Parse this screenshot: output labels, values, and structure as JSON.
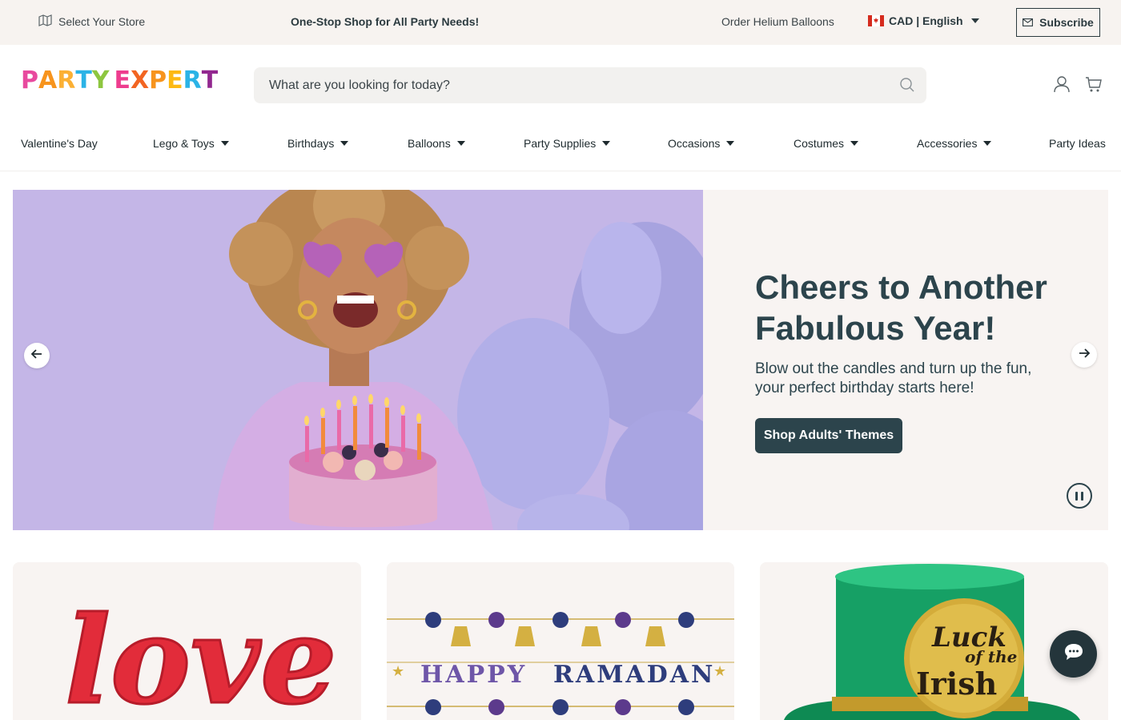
{
  "topbar": {
    "store_label": "Select Your Store",
    "tagline": "One-Stop Shop for All Party Needs!",
    "helium_link": "Order Helium Balloons",
    "locale_label": "CAD | English",
    "subscribe_label": "Subscribe"
  },
  "logo": {
    "word1": [
      "P",
      "A",
      "R",
      "T",
      "Y"
    ],
    "word2": [
      "E",
      "X",
      "P",
      "E",
      "R",
      "T"
    ],
    "colors": [
      "#e84a9e",
      "#f7941d",
      "#fbb034",
      "#2bb3e6",
      "#8dc63f",
      "#ee3c8e",
      "#f26522",
      "#f7941d",
      "#fdb913",
      "#2bb3e6",
      "#92278f"
    ]
  },
  "search": {
    "placeholder": "What are you looking for today?"
  },
  "nav": {
    "items": [
      {
        "label": "Valentine's Day",
        "dropdown": false
      },
      {
        "label": "Lego & Toys",
        "dropdown": true
      },
      {
        "label": "Birthdays",
        "dropdown": true
      },
      {
        "label": "Balloons",
        "dropdown": true
      },
      {
        "label": "Party Supplies",
        "dropdown": true
      },
      {
        "label": "Occasions",
        "dropdown": true
      },
      {
        "label": "Costumes",
        "dropdown": true
      },
      {
        "label": "Accessories",
        "dropdown": true
      },
      {
        "label": "Party Ideas",
        "dropdown": false
      }
    ]
  },
  "hero": {
    "title_line1": "Cheers to Another",
    "title_line2": "Fabulous Year!",
    "subtitle_line1": "Blow out the candles and turn up the fun,",
    "subtitle_line2": "your perfect birthday starts here!",
    "cta_label": "Shop Adults' Themes"
  },
  "cards": {
    "ramadan_text_left": "HAPPY",
    "ramadan_text_right": "RAMADAN",
    "hat_line1": "Luck",
    "hat_line2": "of the",
    "hat_line3": "Irish",
    "love_text": "love"
  },
  "colors": {
    "brand_dark": "#2c444c",
    "topbar_bg": "#f7f3f0",
    "hero_bg": "#f8f4f2"
  },
  "icons": [
    "map-icon",
    "chevron-down-icon",
    "mail-icon",
    "search-icon",
    "user-icon",
    "cart-icon",
    "arrow-left-icon",
    "arrow-right-icon",
    "pause-icon",
    "chat-icon"
  ]
}
